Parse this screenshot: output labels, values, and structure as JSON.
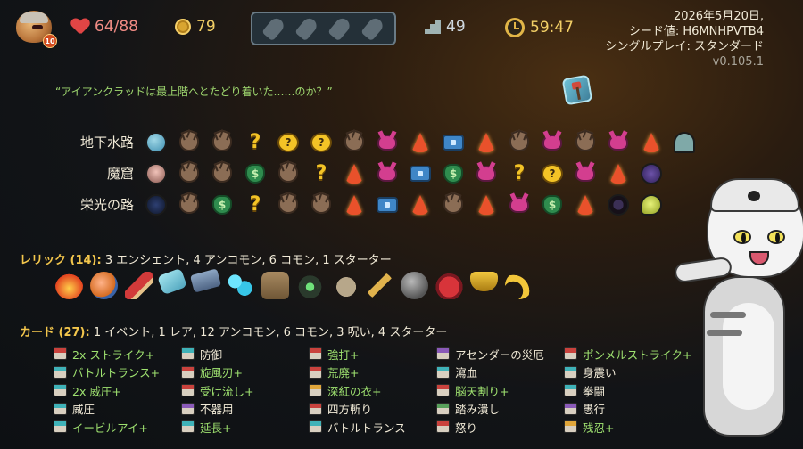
{
  "header": {
    "hp": "64/88",
    "gold": "79",
    "floor": "49",
    "time": "59:47",
    "ascension_level": "10",
    "potion_slots": 4,
    "run_date": "2026年5月20日,",
    "seed": "シード値: H6MNHPVTB4",
    "mode": "シングルプレイ: スタンダード",
    "version": "v0.105.1"
  },
  "quote": "“アイアンクラッドは最上階へとたどり着いた……のか？”",
  "acts": [
    {
      "name": "地下水路",
      "nodes": [
        "boss-slime",
        "monster",
        "monster",
        "event",
        "unknown-monster",
        "unknown-monster",
        "monster",
        "elite",
        "rest",
        "chest",
        "rest",
        "monster",
        "elite",
        "monster",
        "elite",
        "rest",
        "boss-bell"
      ]
    },
    {
      "name": "魔窟",
      "nodes": [
        "boss-skull",
        "monster",
        "monster",
        "shop",
        "monster",
        "event",
        "rest",
        "elite",
        "chest",
        "shop",
        "elite",
        "event",
        "unknown-monster",
        "elite",
        "rest",
        "boss-crab"
      ]
    },
    {
      "name": "栄光の路",
      "nodes": [
        "boss-horned",
        "monster",
        "shop",
        "event",
        "monster",
        "monster",
        "rest",
        "chest",
        "rest",
        "monster",
        "rest",
        "elite",
        "shop",
        "rest",
        "boss-eye",
        "boss-worm"
      ]
    }
  ],
  "relics": {
    "title": "レリック (14):",
    "summary": "3 エンシェント, 4 アンコモン, 6 コモン, 1 スターター",
    "items": [
      "burning-blood-icon",
      "orange-orb-icon",
      "lipstick-icon",
      "ticket-icon",
      "whetstone-icon",
      "blue-flames-icon",
      "backpack-icon",
      "lantern-icon",
      "bag-of-seeds-icon",
      "golden-quill-icon",
      "stone-icon",
      "jar-icon",
      "golden-belt-icon",
      "horn-icon"
    ]
  },
  "cards": {
    "title": "カード (27):",
    "summary": "1 イベント, 1 レア, 12 アンコモン, 6 コモン, 3 呪い, 4 スターター",
    "columns": [
      [
        {
          "name": "2x ストライク+",
          "upgraded": true,
          "type": "attack"
        },
        {
          "name": "バトルトランス+",
          "upgraded": true,
          "type": "skill"
        },
        {
          "name": "2x 威圧+",
          "upgraded": true,
          "type": "skill"
        },
        {
          "name": "威圧",
          "upgraded": false,
          "type": "skill"
        },
        {
          "name": "イービルアイ+",
          "upgraded": true,
          "type": "skill"
        }
      ],
      [
        {
          "name": "防御",
          "upgraded": false,
          "type": "skill"
        },
        {
          "name": "旋風刃+",
          "upgraded": true,
          "type": "attack"
        },
        {
          "name": "受け流し+",
          "upgraded": true,
          "type": "attack"
        },
        {
          "name": "不器用",
          "upgraded": false,
          "type": "curse"
        },
        {
          "name": "延長+",
          "upgraded": true,
          "type": "skill"
        }
      ],
      [
        {
          "name": "強打+",
          "upgraded": true,
          "type": "attack"
        },
        {
          "name": "荒廃+",
          "upgraded": true,
          "type": "attack"
        },
        {
          "name": "深紅の衣+",
          "upgraded": true,
          "type": "power"
        },
        {
          "name": "四方斬り",
          "upgraded": false,
          "type": "attack"
        },
        {
          "name": "バトルトランス",
          "upgraded": false,
          "type": "skill"
        }
      ],
      [
        {
          "name": "アセンダーの災厄",
          "upgraded": false,
          "type": "curse"
        },
        {
          "name": "瀉血",
          "upgraded": false,
          "type": "skill"
        },
        {
          "name": "脳天割り+",
          "upgraded": true,
          "type": "attack"
        },
        {
          "name": "踏み潰し",
          "upgraded": false,
          "type": "event"
        },
        {
          "name": "怒り",
          "upgraded": false,
          "type": "attack"
        }
      ],
      [
        {
          "name": "ポンメルストライク+",
          "upgraded": true,
          "type": "attack"
        },
        {
          "name": "身震い",
          "upgraded": false,
          "type": "skill"
        },
        {
          "name": "拳闘",
          "upgraded": false,
          "type": "skill"
        },
        {
          "name": "愚行",
          "upgraded": false,
          "type": "curse"
        },
        {
          "name": "残忍+",
          "upgraded": true,
          "type": "power"
        }
      ]
    ]
  }
}
